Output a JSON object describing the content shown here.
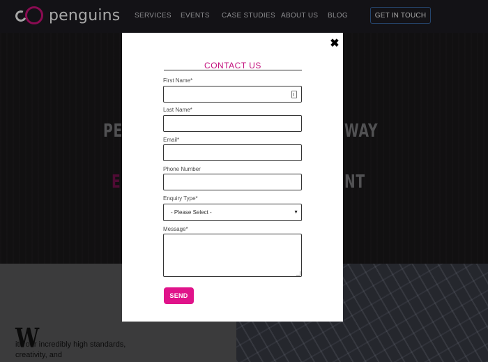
{
  "header": {
    "logo_text": "penguins",
    "nav": [
      "SERVICES",
      "EVENTS",
      "CASE STUDIES",
      "ABOUT US",
      "BLOG"
    ],
    "cta_label": "GET IN TOUCH"
  },
  "hero": {
    "line1_left": "PE",
    "line1_right": "WAY",
    "line2_left": "E",
    "line2_right": "NT"
  },
  "intro": {
    "dropcap": "W",
    "text": "ith our incredibly high standards, creativity, and"
  },
  "modal": {
    "close_icon": "✖",
    "title": "CONTACT US",
    "fields": {
      "first_name_label": "First Name*",
      "last_name_label": "Last Name*",
      "email_label": "Email*",
      "phone_label": "Phone Number",
      "enquiry_label": "Enquiry Type*",
      "enquiry_selected": "- Please Select -",
      "message_label": "Message*"
    },
    "send_label": "SEND"
  },
  "colors": {
    "brand_pink": "#d4117f",
    "send_button": "#e0138a",
    "cta_border": "#3a6aa8"
  }
}
